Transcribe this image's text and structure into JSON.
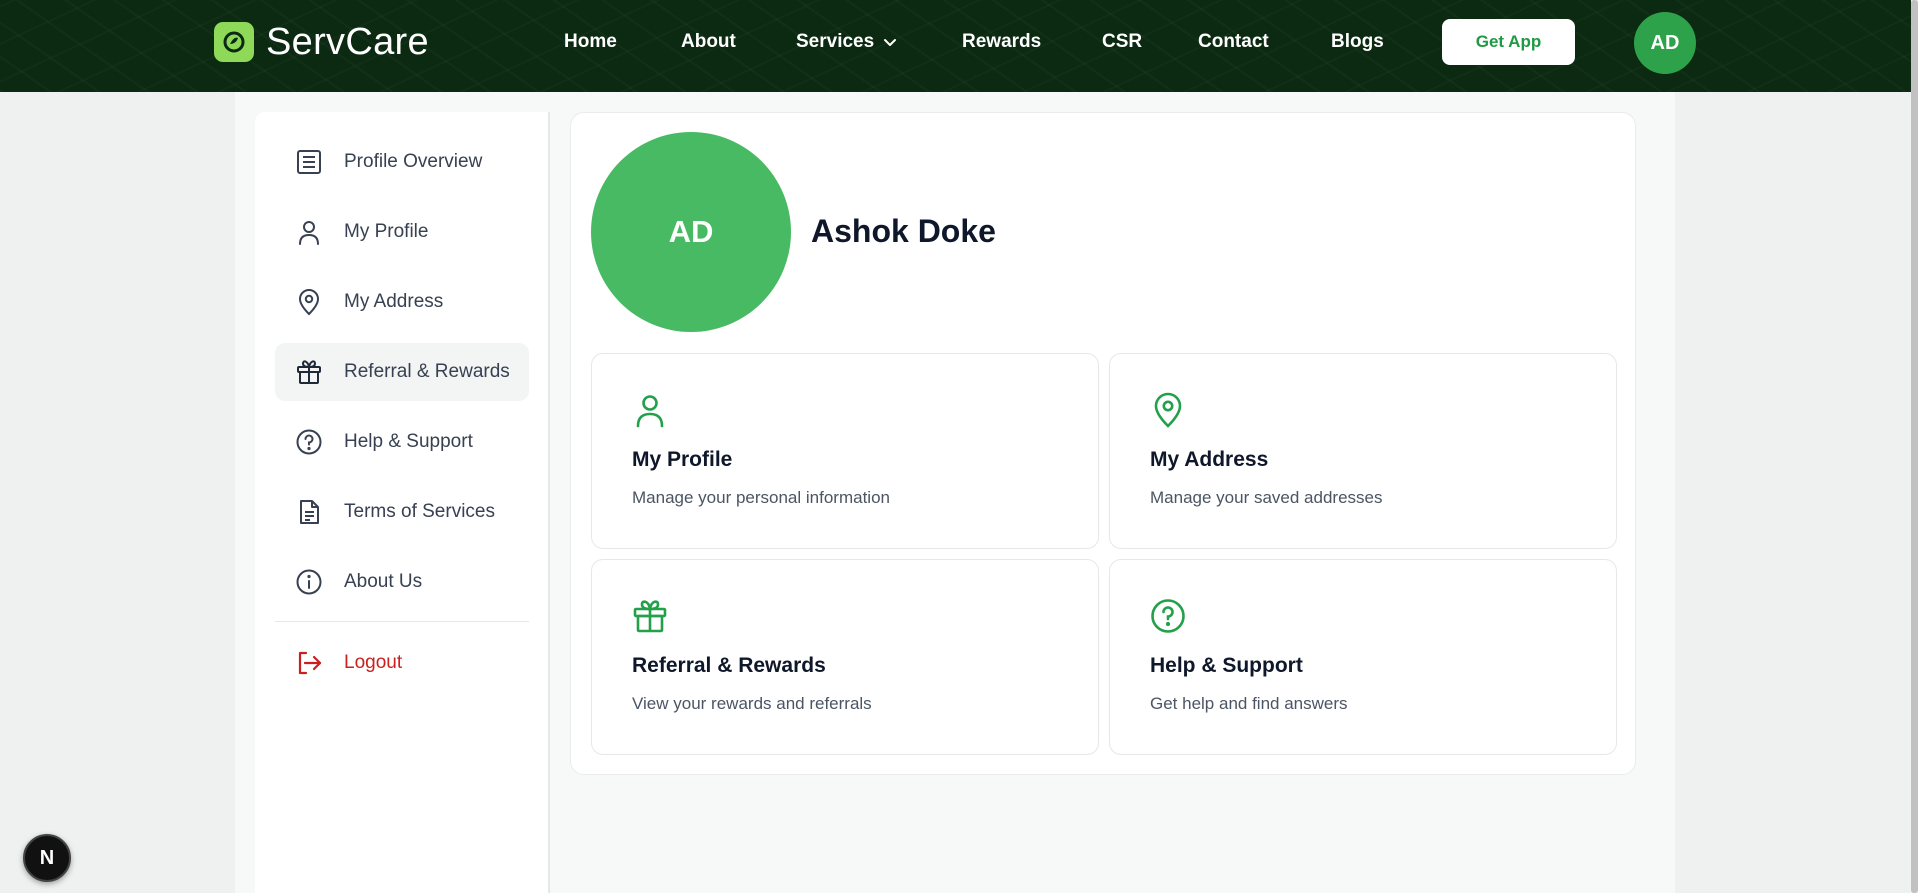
{
  "header": {
    "brand": "ServCare",
    "nav": [
      {
        "label": "Home"
      },
      {
        "label": "About"
      },
      {
        "label": "Services"
      },
      {
        "label": "Rewards"
      },
      {
        "label": "CSR"
      },
      {
        "label": "Contact"
      },
      {
        "label": "Blogs"
      }
    ],
    "get_app_label": "Get App",
    "avatar_initials": "AD"
  },
  "sidebar": {
    "items": [
      {
        "label": "Profile Overview",
        "icon": "list-icon"
      },
      {
        "label": "My Profile",
        "icon": "user-icon"
      },
      {
        "label": "My Address",
        "icon": "map-pin-icon"
      },
      {
        "label": "Referral & Rewards",
        "icon": "gift-icon",
        "active": true
      },
      {
        "label": "Help & Support",
        "icon": "help-circle-icon"
      },
      {
        "label": "Terms of Services",
        "icon": "document-icon"
      },
      {
        "label": "About Us",
        "icon": "info-icon"
      }
    ],
    "logout_label": "Logout"
  },
  "profile": {
    "initials": "AD",
    "name": "Ashok Doke"
  },
  "cards": [
    {
      "title": "My Profile",
      "desc": "Manage your personal information",
      "icon": "user-icon"
    },
    {
      "title": "My Address",
      "desc": "Manage your saved addresses",
      "icon": "map-pin-icon"
    },
    {
      "title": "Referral & Rewards",
      "desc": "View your rewards and referrals",
      "icon": "gift-icon"
    },
    {
      "title": "Help & Support",
      "desc": "Get help and find answers",
      "icon": "help-circle-icon"
    }
  ],
  "dev_badge": "N",
  "colors": {
    "header_bg": "#0c2a12",
    "brand_green": "#2ea24a",
    "accent_green": "#1f9a43",
    "logo_green": "#8ed957",
    "logout_red": "#cc1f1f"
  }
}
